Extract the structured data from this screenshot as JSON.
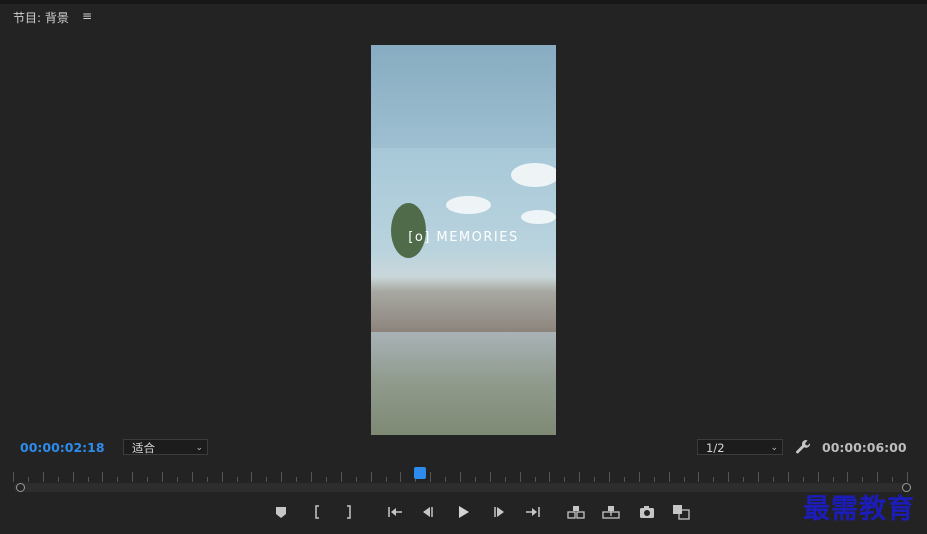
{
  "panel": {
    "title": "节目: 背景",
    "menu_icon": "hamburger-icon"
  },
  "video": {
    "overlay_text": "[o] MEMORIES"
  },
  "timecode": {
    "current": "00:00:02:18",
    "total": "00:00:06:00"
  },
  "zoom": {
    "selected": "适合"
  },
  "resolution": {
    "selected": "1/2"
  },
  "watermark": {
    "text": "最需教育"
  },
  "colors": {
    "accent": "#2d8ceb",
    "panel_bg": "#232323"
  },
  "controls": [
    "add-marker-icon",
    "mark-in-icon",
    "mark-out-icon",
    "go-to-in-icon",
    "step-back-icon",
    "play-icon",
    "step-forward-icon",
    "go-to-out-icon",
    "insert-icon",
    "overwrite-icon",
    "export-frame-icon",
    "compare-view-icon"
  ]
}
